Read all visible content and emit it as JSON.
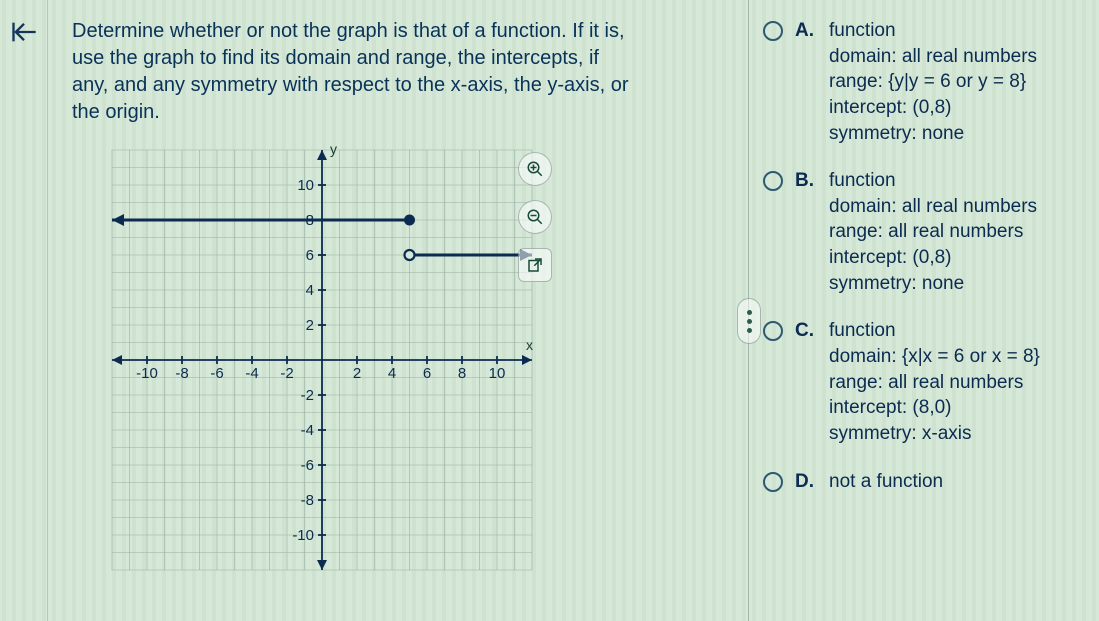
{
  "nav": {
    "collapse_name": "collapse"
  },
  "question": {
    "text": "Determine whether or not the graph is that of a function. If it is, use the graph to find its domain and range, the intercepts, if any, and any symmetry with respect to the x-axis, the y-axis, or the origin."
  },
  "chart_data": {
    "type": "line",
    "xlabel": "x",
    "ylabel": "y",
    "xlim": [
      -12,
      12
    ],
    "ylim": [
      -12,
      12
    ],
    "x_ticks": [
      -10,
      -8,
      -6,
      -4,
      -2,
      2,
      4,
      6,
      8,
      10
    ],
    "y_ticks": [
      -10,
      -8,
      -6,
      -4,
      -2,
      2,
      4,
      6,
      8,
      10
    ],
    "segments": [
      {
        "from": [
          -12,
          8
        ],
        "to": [
          5,
          8
        ],
        "left_arrow": true,
        "right_closed": true
      },
      {
        "from": [
          5,
          6
        ],
        "to": [
          12,
          6
        ],
        "left_open": true,
        "right_arrow": true
      }
    ]
  },
  "tools": {
    "zoom_in": "zoom-in",
    "zoom_out": "zoom-out",
    "popout": "open-in-new"
  },
  "options": [
    {
      "letter": "A.",
      "lines": [
        "function",
        "domain: all real numbers",
        "range: {y|y = 6 or y = 8}",
        "intercept: (0,8)",
        "symmetry: none"
      ]
    },
    {
      "letter": "B.",
      "lines": [
        "function",
        "domain: all real numbers",
        "range: all real numbers",
        "intercept: (0,8)",
        "symmetry: none"
      ]
    },
    {
      "letter": "C.",
      "lines": [
        "function",
        "domain: {x|x = 6 or x = 8}",
        "range: all real numbers",
        "intercept: (8,0)",
        "symmetry: x-axis"
      ]
    },
    {
      "letter": "D.",
      "lines": [
        "not a function"
      ]
    }
  ]
}
